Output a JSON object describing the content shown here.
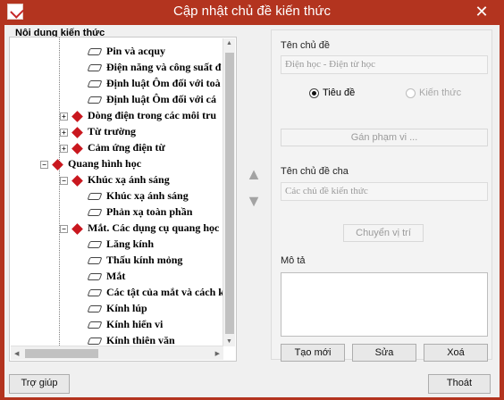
{
  "window": {
    "title": "Cập nhật chủ đề kiến thức",
    "close_glyph": "✕"
  },
  "tree": {
    "header": "Nội dung kiến thức",
    "items": [
      {
        "label": "Pin và acquy",
        "kind": "leaf"
      },
      {
        "label": "Điện năng và công suất đ",
        "kind": "leaf"
      },
      {
        "label": "Định luật Ôm đối với toà",
        "kind": "leaf"
      },
      {
        "label": "Định luật Ôm đối với cá",
        "kind": "leaf"
      },
      {
        "label": "Dòng điện trong các môi tru",
        "kind": "collapsed",
        "expander": "+"
      },
      {
        "label": "Từ trường",
        "kind": "collapsed",
        "expander": "+"
      },
      {
        "label": "Cảm ứng điện từ",
        "kind": "collapsed",
        "expander": "+"
      },
      {
        "label": "Quang hình học",
        "kind": "expanded",
        "expander": "−"
      },
      {
        "label": "Khúc xạ ánh sáng",
        "kind": "expanded",
        "expander": "−"
      },
      {
        "label": "Khúc xạ ánh sáng",
        "kind": "leaf"
      },
      {
        "label": "Phản xạ toàn phần",
        "kind": "leaf"
      },
      {
        "label": "Mắt. Các dụng cụ quang học",
        "kind": "expanded",
        "expander": "−"
      },
      {
        "label": "Lăng kính",
        "kind": "leaf"
      },
      {
        "label": "Thấu kính mỏng",
        "kind": "leaf"
      },
      {
        "label": "Mắt",
        "kind": "leaf"
      },
      {
        "label": "Các tật của mắt và cách k",
        "kind": "leaf"
      },
      {
        "label": "Kính lúp",
        "kind": "leaf"
      },
      {
        "label": "Kính hiển vi",
        "kind": "leaf"
      },
      {
        "label": "Kính thiên văn",
        "kind": "leaf"
      }
    ]
  },
  "move": {
    "up": "▲",
    "down": "▼"
  },
  "form": {
    "topic_name_label": "Tên chủ đề",
    "topic_name_value": "Điện học - Điện từ học",
    "radio_title": "Tiêu đề",
    "radio_knowledge": "Kiến thức",
    "assign_scope_button": "Gán phạm vi ...",
    "parent_topic_label": "Tên chủ đề cha",
    "parent_topic_value": "Các chủ đề kiến thức",
    "move_position_button": "Chuyển vị trí",
    "description_label": "Mô tả",
    "new_button": "Tạo mới",
    "edit_button": "Sửa",
    "delete_button": "Xoá"
  },
  "footer": {
    "help_button": "Trợ giúp",
    "exit_button": "Thoát"
  },
  "colors": {
    "titlebar": "#b3341f",
    "red_node": "#c9171e",
    "window_bg": "#f0f0f0"
  }
}
